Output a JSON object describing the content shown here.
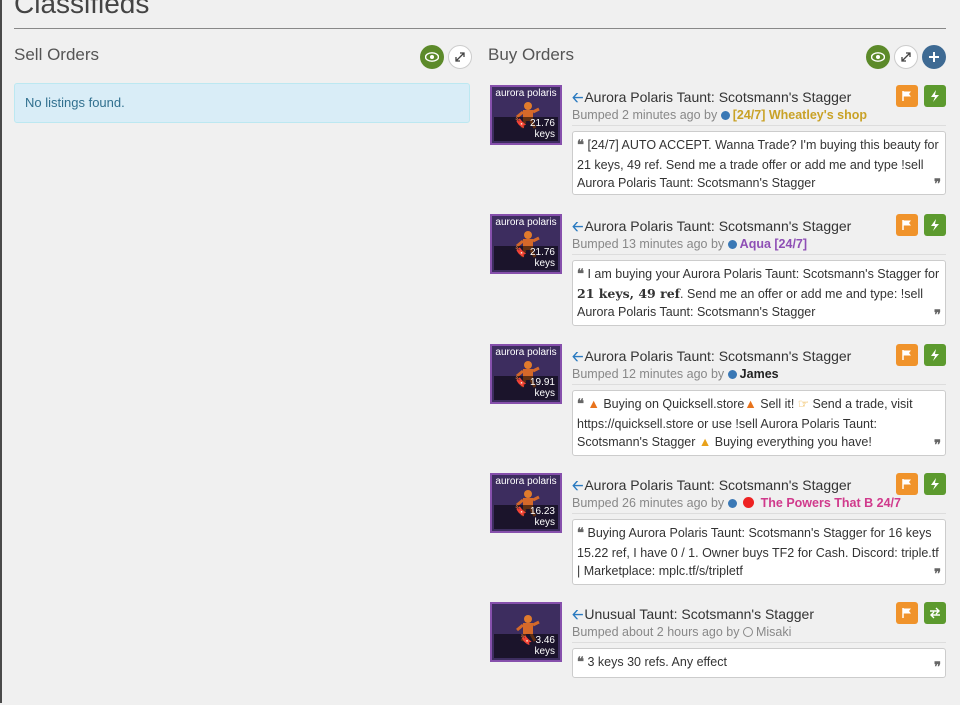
{
  "page": {
    "title": "Classifieds"
  },
  "sell": {
    "title": "Sell Orders",
    "empty_text": "No listings found."
  },
  "buy": {
    "title": "Buy Orders",
    "listings": [
      {
        "img_label": "aurora polaris",
        "price": "21.76 keys",
        "title": "Aurora Polaris Taunt: Scotsmann's Stagger",
        "bumped": "Bumped 2 minutes ago by",
        "user": "[24/7] Wheatley's shop",
        "user_color": "#c9a227",
        "comment": "[24/7] AUTO ACCEPT. Wanna Trade? I'm buying this beauty for 21 keys, 49 ref. Send me a trade offer or add me and type !sell Aurora Polaris Taunt: Scotsmann's Stagger"
      },
      {
        "img_label": "aurora polaris",
        "price": "21.76 keys",
        "title": "Aurora Polaris Taunt: Scotsmann's Stagger",
        "bumped": "Bumped 13 minutes ago by",
        "user": "Aqua [24/7]",
        "user_color": "#8e4fb5",
        "comment_pre": "I am buying your Aurora Polaris Taunt: Scotsmann's Stagger for ",
        "comment_bold": "21 keys, 49 ref",
        "comment_post": ". Send me an offer or add me and type: !sell Aurora Polaris Taunt: Scotsmann's Stagger"
      },
      {
        "img_label": "aurora polaris",
        "price": "19.91 keys",
        "title": "Aurora Polaris Taunt: Scotsmann's Stagger",
        "bumped": "Bumped 12 minutes ago by",
        "user": "James",
        "user_color": "#222222",
        "comment_a": "Buying on Quicksell.store",
        "comment_b": "Sell it!",
        "comment_c": "Send a trade, visit https://quicksell.store or use !sell Aurora Polaris Taunt: Scotsmann's Stagger",
        "comment_d": "Buying everything you have!"
      },
      {
        "img_label": "aurora polaris",
        "price": "16.23 keys",
        "title": "Aurora Polaris Taunt: Scotsmann's Stagger",
        "bumped": "Bumped 26 minutes ago by",
        "user": "The Powers That B 24/7",
        "user_color": "#d03a8c",
        "comment": "Buying Aurora Polaris Taunt: Scotsmann's Stagger for 16 keys 15.22 ref, I have 0 / 1. Owner buys TF2 for Cash. Discord: triple.tf | Marketplace: mplc.tf/s/tripletf"
      },
      {
        "img_label": "",
        "price": "3.46 keys",
        "title": "Unusual Taunt: Scotsmann's Stagger",
        "bumped": "Bumped about 2 hours ago by",
        "user": "Misaki",
        "user_color": "#888888",
        "comment": "3 keys 30 refs. Any effect"
      }
    ]
  },
  "colors": {
    "accent_green": "#5c8a2a",
    "flag_orange": "#f0932b",
    "info_blue": "#d9edf7",
    "item_purple": "#8650ac"
  }
}
